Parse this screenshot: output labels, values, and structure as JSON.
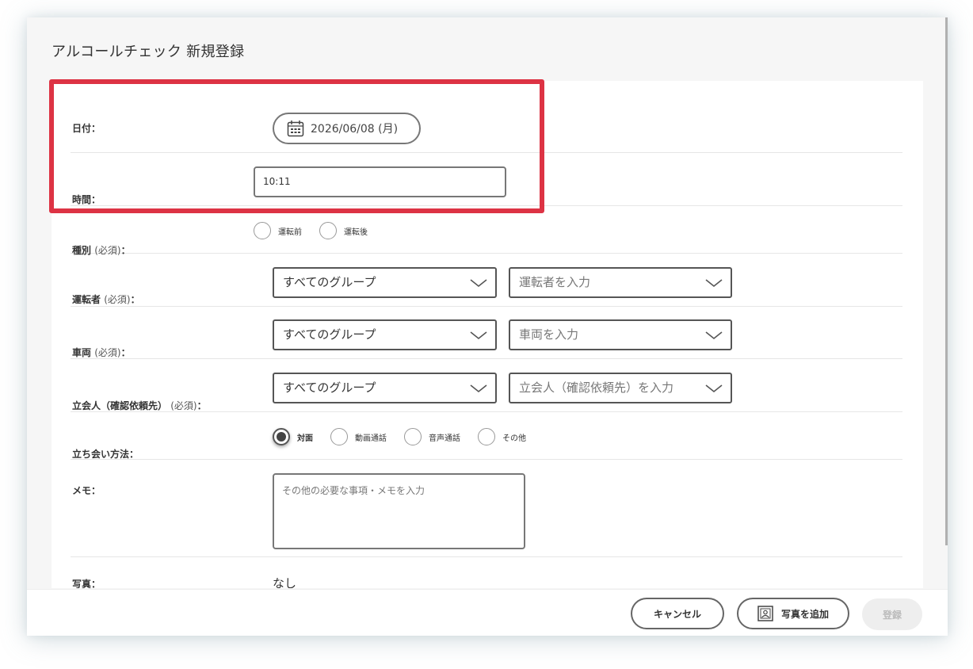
{
  "modal": {
    "title": "アルコールチェック 新規登録"
  },
  "form": {
    "date": {
      "label": "日付：",
      "value": "2026/06/08 (月)",
      "icon": "calendar-icon"
    },
    "time": {
      "label": "時間：",
      "value": "10:11"
    },
    "type": {
      "label": "種別",
      "required": "(必須)",
      "colon": "：",
      "options": [
        "運転前",
        "運転後"
      ]
    },
    "driver": {
      "label": "運転者",
      "required": "(必須)",
      "colon": "：",
      "group_value": "すべてのグループ",
      "placeholder": "運転者を入力"
    },
    "vehicle": {
      "label": "車両",
      "required": "(必須)",
      "colon": "：",
      "group_value": "すべてのグループ",
      "placeholder": "車両を入力"
    },
    "witness": {
      "label": "立会人（確認依頼先）",
      "required": "(必須)",
      "colon": "：",
      "group_value": "すべてのグループ",
      "placeholder": "立会人（確認依頼先）を入力"
    },
    "method": {
      "label": "立ち会い方法：",
      "options": [
        "対面",
        "動画通話",
        "音声通話",
        "その他"
      ],
      "selected": "対面"
    },
    "memo": {
      "label": "メモ：",
      "placeholder": "その他の必要な事項・メモを入力"
    },
    "photo": {
      "label": "写真：",
      "value": "なし"
    }
  },
  "footer": {
    "cancel_label": "キャンセル",
    "add_photo_label": "写真を追加",
    "add_photo_icon": "photo-icon",
    "register_label": "登録"
  },
  "colors": {
    "highlight": "#dd3344",
    "disabled_button_bg": "#eeeeee",
    "disabled_button_text": "#bbbbbb"
  }
}
